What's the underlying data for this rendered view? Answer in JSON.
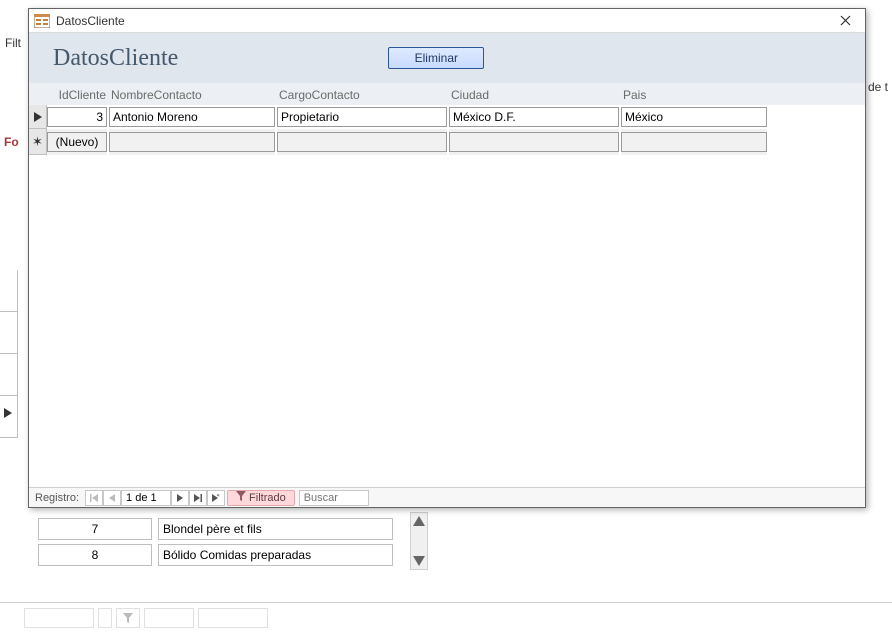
{
  "window": {
    "title": "DatosCliente"
  },
  "formHeader": {
    "title": "DatosCliente",
    "eliminar_label": "Eliminar"
  },
  "columns": {
    "id": "IdCliente",
    "nombre": "NombreContacto",
    "cargo": "CargoContacto",
    "ciudad": "Ciudad",
    "pais": "Pais"
  },
  "rows": [
    {
      "id": "3",
      "nombre": "Antonio Moreno",
      "cargo": "Propietario",
      "ciudad": "México D.F.",
      "pais": "México"
    }
  ],
  "newRowLabel": "(Nuevo)",
  "nav": {
    "label": "Registro:",
    "position": "1 de 1",
    "filter_label": "Filtrado",
    "search_placeholder": "Buscar"
  },
  "behindList": [
    {
      "id": "7",
      "name": "Blondel père et fils"
    },
    {
      "id": "8",
      "name": "Bólido Comidas preparadas"
    }
  ],
  "bgLabels": {
    "filt": "Filt",
    "fo": "Fo",
    "de_te": "de t"
  }
}
